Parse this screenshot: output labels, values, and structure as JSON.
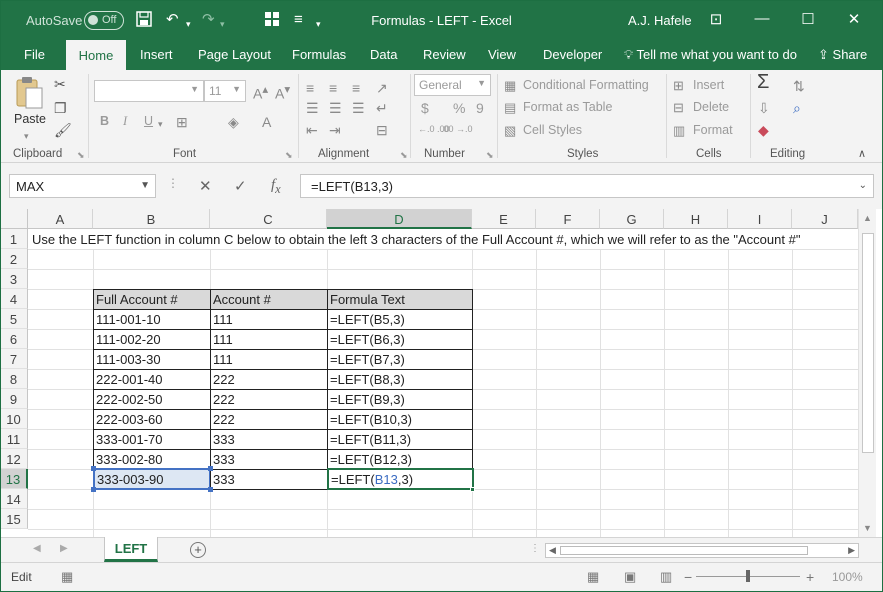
{
  "titlebar": {
    "autosave_label": "AutoSave",
    "autosave_state": "Off",
    "title": "Formulas - LEFT  -  Excel",
    "user": "A.J. Hafele",
    "icons": [
      "save-icon",
      "undo-icon",
      "redo-icon",
      "layout-icon",
      "customize-icon"
    ]
  },
  "tabs": {
    "items": [
      "File",
      "Home",
      "Insert",
      "Page Layout",
      "Formulas",
      "Data",
      "Review",
      "View",
      "Developer"
    ],
    "active": "Home",
    "tell_me": "Tell me what you want to do",
    "share": "Share"
  },
  "ribbon": {
    "clipboard": {
      "paste": "Paste",
      "label": "Clipboard"
    },
    "font": {
      "size": "11",
      "bold": "B",
      "italic": "I",
      "underline": "U",
      "label": "Font"
    },
    "alignment": {
      "label": "Alignment"
    },
    "number": {
      "format": "General",
      "currency": "$",
      "percent": "%",
      "comma": "9",
      "inc_dec": "←.0 .00",
      "dec_dec": ".00 →.0",
      "label": "Number"
    },
    "styles": {
      "conditional": "Conditional Formatting",
      "format_table": "Format as Table",
      "cell_styles": "Cell Styles",
      "label": "Styles"
    },
    "cells": {
      "insert": "Insert",
      "delete": "Delete",
      "format": "Format",
      "label": "Cells"
    },
    "editing": {
      "label": "Editing"
    }
  },
  "formula_bar": {
    "name_box": "MAX",
    "formula": "=LEFT(B13,3)"
  },
  "columns": [
    "A",
    "B",
    "C",
    "D",
    "E",
    "F",
    "G",
    "H",
    "I",
    "J"
  ],
  "selected_column": "D",
  "rows": [
    "1",
    "2",
    "3",
    "4",
    "5",
    "6",
    "7",
    "8",
    "9",
    "10",
    "11",
    "12",
    "13",
    "14",
    "15"
  ],
  "selected_row": "13",
  "sheet": {
    "a1_text": "Use the LEFT function in column C below to obtain the left 3 characters of the Full Account #, which we will refer to as the \"Account #\"",
    "table": {
      "headers": [
        "Full Account #",
        "Account #",
        "Formula Text"
      ],
      "rows": [
        [
          "111-001-10",
          "111",
          "=LEFT(B5,3)"
        ],
        [
          "111-002-20",
          "111",
          "=LEFT(B6,3)"
        ],
        [
          "111-003-30",
          "111",
          "=LEFT(B7,3)"
        ],
        [
          "222-001-40",
          "222",
          "=LEFT(B8,3)"
        ],
        [
          "222-002-50",
          "222",
          "=LEFT(B9,3)"
        ],
        [
          "222-003-60",
          "222",
          "=LEFT(B10,3)"
        ],
        [
          "333-001-70",
          "333",
          "=LEFT(B11,3)"
        ],
        [
          "333-002-80",
          "333",
          "=LEFT(B12,3)"
        ],
        [
          "333-003-90",
          "333",
          ""
        ]
      ],
      "editing_cell": {
        "prefix": "=LEFT(",
        "ref": "B13",
        "suffix": ",3)"
      }
    }
  },
  "sheet_tabs": {
    "active": "LEFT"
  },
  "status": {
    "mode": "Edit",
    "zoom": "100%"
  },
  "colors": {
    "accent": "#217346",
    "ref_blue": "#3b6cc2",
    "header_fill": "#d9d9d9"
  }
}
